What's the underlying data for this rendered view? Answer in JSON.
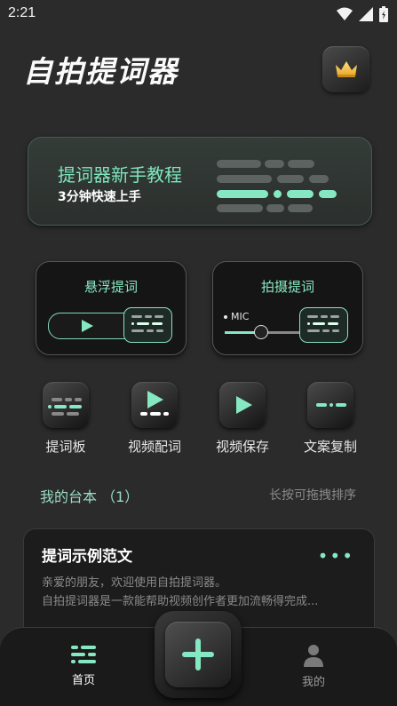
{
  "status_bar": {
    "time": "2:21"
  },
  "header": {
    "app_title": "自拍提词器"
  },
  "tutorial": {
    "title": "提词器新手教程",
    "subtitle": "3分钟快速上手"
  },
  "modes": [
    {
      "label": "悬浮提词"
    },
    {
      "label": "拍摄提词",
      "mic_label": "MIC"
    }
  ],
  "shortcuts": [
    {
      "label": "提词板",
      "icon": "teleprompter-board-icon"
    },
    {
      "label": "视频配词",
      "icon": "video-lyrics-icon"
    },
    {
      "label": "视频保存",
      "icon": "video-save-icon"
    },
    {
      "label": "文案复制",
      "icon": "copy-text-icon"
    }
  ],
  "scripts_section": {
    "title": "我的台本 （1）",
    "hint": "长按可拖拽排序"
  },
  "scripts": [
    {
      "title": "提词示例范文",
      "line1": "亲爱的朋友，欢迎使用自拍提词器。",
      "line2": "自拍提词器是一款能帮助视频创作者更加流畅得完成..."
    }
  ],
  "tabbar": {
    "home": "首页",
    "profile": "我的"
  },
  "colors": {
    "accent": "#86e8c2",
    "background": "#2b2b2b"
  }
}
